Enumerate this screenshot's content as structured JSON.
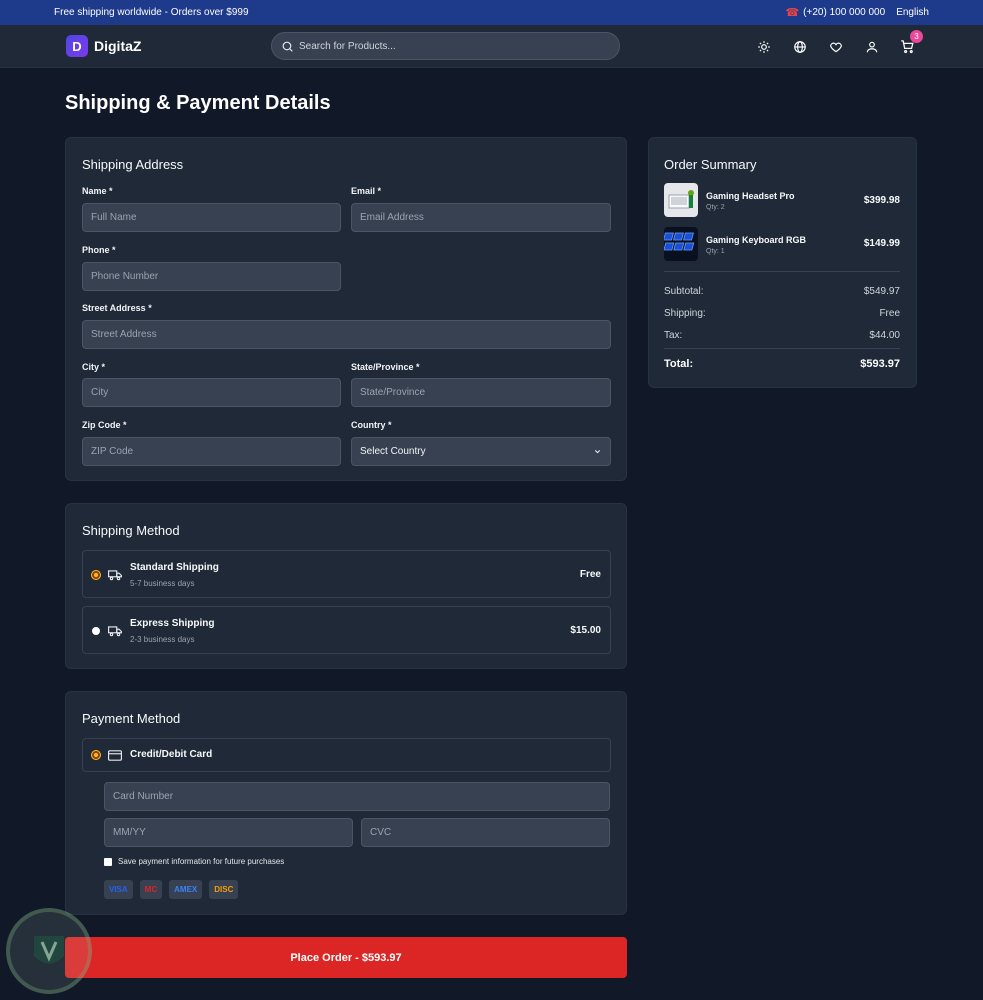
{
  "topbar": {
    "promo": "Free shipping worldwide - Orders over $999",
    "phone": "(+20) 100 000 000",
    "language": "English"
  },
  "header": {
    "logo_letter": "D",
    "logo_text": "DigitaZ",
    "search_placeholder": "Search for Products...",
    "cart_count": "3",
    "icons": [
      "sun-icon",
      "globe-icon",
      "heart-icon",
      "user-icon",
      "cart-icon"
    ]
  },
  "page": {
    "title": "Shipping & Payment Details"
  },
  "shipping_address": {
    "title": "Shipping Address",
    "name_label": "Name *",
    "name_placeholder": "Full Name",
    "email_label": "Email *",
    "email_placeholder": "Email Address",
    "phone_label": "Phone *",
    "phone_placeholder": "Phone Number",
    "street_label": "Street Address *",
    "street_placeholder": "Street Address",
    "city_label": "City *",
    "city_placeholder": "City",
    "state_label": "State/Province *",
    "state_placeholder": "State/Province",
    "zip_label": "Zip Code *",
    "zip_placeholder": "ZIP Code",
    "country_label": "Country *",
    "country_value": "Select Country"
  },
  "shipping_method": {
    "title": "Shipping Method",
    "options": [
      {
        "name": "Standard Shipping",
        "eta": "5-7 business days",
        "price": "Free",
        "selected": true
      },
      {
        "name": "Express Shipping",
        "eta": "2-3 business days",
        "price": "$15.00",
        "selected": false
      }
    ]
  },
  "payment_method": {
    "title": "Payment Method",
    "option_label": "Credit/Debit Card",
    "card_number_placeholder": "Card Number",
    "expiry_placeholder": "MM/YY",
    "cvc_placeholder": "CVC",
    "save_label": "Save payment information for future purchases",
    "card_brands": [
      "VISA",
      "MC",
      "AMEX",
      "DISC"
    ]
  },
  "place_order_label": "Place Order - $593.97",
  "order_summary": {
    "title": "Order Summary",
    "items": [
      {
        "name": "Gaming Headset Pro",
        "qty": "Qty: 2",
        "price": "$399.98"
      },
      {
        "name": "Gaming Keyboard RGB",
        "qty": "Qty: 1",
        "price": "$149.99"
      }
    ],
    "subtotal_label": "Subtotal:",
    "subtotal_value": "$549.97",
    "shipping_label": "Shipping:",
    "shipping_value": "Free",
    "tax_label": "Tax:",
    "tax_value": "$44.00",
    "total_label": "Total:",
    "total_value": "$593.97"
  },
  "colors": {
    "background": "#111827",
    "card": "#1f2937",
    "topbar": "#1e3a8a",
    "accent_red": "#dc2626",
    "radio_selected": "#fbbf24",
    "badge": "#ec4899"
  }
}
